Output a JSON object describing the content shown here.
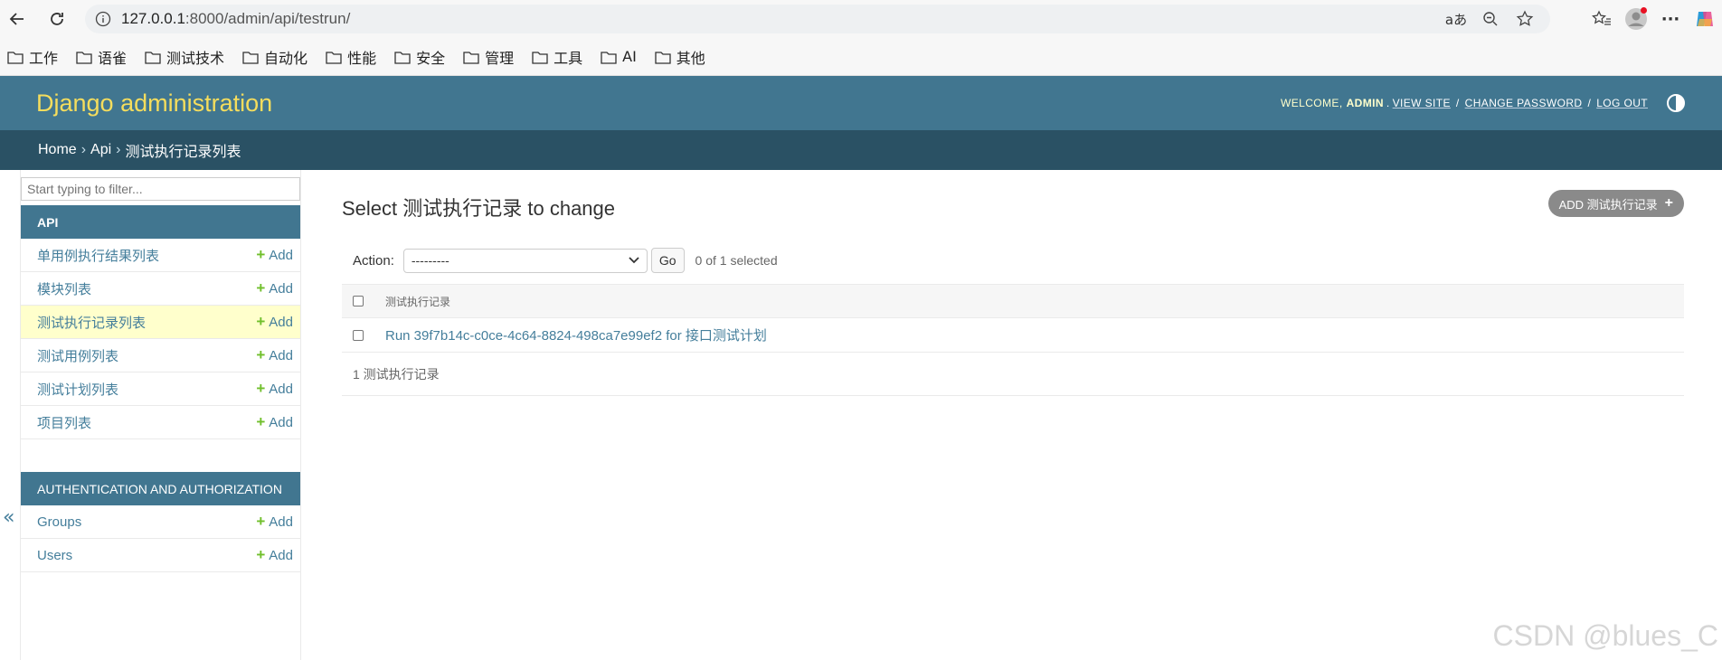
{
  "browser": {
    "url_host": "127.0.0.1",
    "url_rest": ":8000/admin/api/testrun/",
    "translate_label": "aあ",
    "bookmarks": [
      "工作",
      "语雀",
      "测试技术",
      "自动化",
      "性能",
      "安全",
      "管理",
      "工具",
      "AI",
      "其他"
    ]
  },
  "header": {
    "brand": "Django administration",
    "welcome": "Welcome,",
    "user": "admin",
    "view_site": "View site",
    "change_password": "Change password",
    "log_out": "Log out"
  },
  "breadcrumbs": {
    "home": "Home",
    "app": "Api",
    "current": "测试执行记录列表"
  },
  "sidebar": {
    "filter_placeholder": "Start typing to filter...",
    "api_caption": "API",
    "api_models": [
      {
        "label": "单用例执行结果列表",
        "add": "Add"
      },
      {
        "label": "模块列表",
        "add": "Add"
      },
      {
        "label": "测试执行记录列表",
        "add": "Add"
      },
      {
        "label": "测试用例列表",
        "add": "Add"
      },
      {
        "label": "测试计划列表",
        "add": "Add"
      },
      {
        "label": "项目列表",
        "add": "Add"
      }
    ],
    "auth_caption": "Authentication and Authorization",
    "auth_models": [
      {
        "label": "Groups",
        "add": "Add"
      },
      {
        "label": "Users",
        "add": "Add"
      }
    ],
    "collapse_label": "«"
  },
  "content": {
    "title": "Select 测试执行记录 to change",
    "add_button": "ADD 测试执行记录",
    "action_label": "Action:",
    "action_selected": "---------",
    "go_label": "Go",
    "counter": "0 of 1 selected",
    "column_header": "测试执行记录",
    "rows": [
      "Run 39f7b14c-c0ce-4c64-8824-498ca7e99ef2 for 接口测试计划"
    ],
    "paginator": "1 测试执行记录"
  },
  "watermark": "CSDN @blues_C"
}
